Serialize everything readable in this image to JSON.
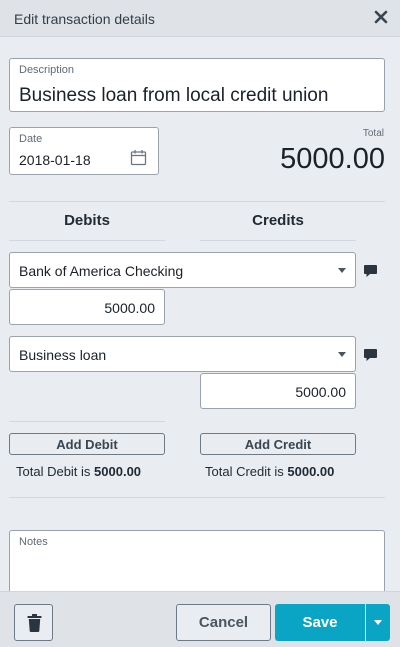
{
  "header": {
    "title": "Edit transaction details"
  },
  "description": {
    "label": "Description",
    "value": "Business loan from local credit union"
  },
  "date": {
    "label": "Date",
    "value": "2018-01-18"
  },
  "total": {
    "label": "Total",
    "value": "5000.00"
  },
  "columns": {
    "debits": "Debits",
    "credits": "Credits"
  },
  "entries": [
    {
      "account": "Bank of America Checking",
      "amount": "5000.00",
      "side": "debit"
    },
    {
      "account": "Business loan",
      "amount": "5000.00",
      "side": "credit"
    }
  ],
  "actions": {
    "add_debit": "Add Debit",
    "add_credit": "Add Credit"
  },
  "totals": {
    "debit_prefix": "Total Debit is ",
    "debit_value": "5000.00",
    "credit_prefix": "Total Credit is ",
    "credit_value": "5000.00"
  },
  "notes": {
    "label": "Notes",
    "value": ""
  },
  "footer": {
    "cancel_label": "Cancel",
    "save_label": "Save"
  },
  "icons": {
    "close": "close-icon",
    "calendar": "calendar-icon",
    "note": "speech-bubble-icon",
    "trash": "trash-icon",
    "dropdown": "chevron-down-icon"
  },
  "colors": {
    "accent": "#0aa5c4",
    "background": "#e9ecf0",
    "header": "#dfe3e8"
  }
}
